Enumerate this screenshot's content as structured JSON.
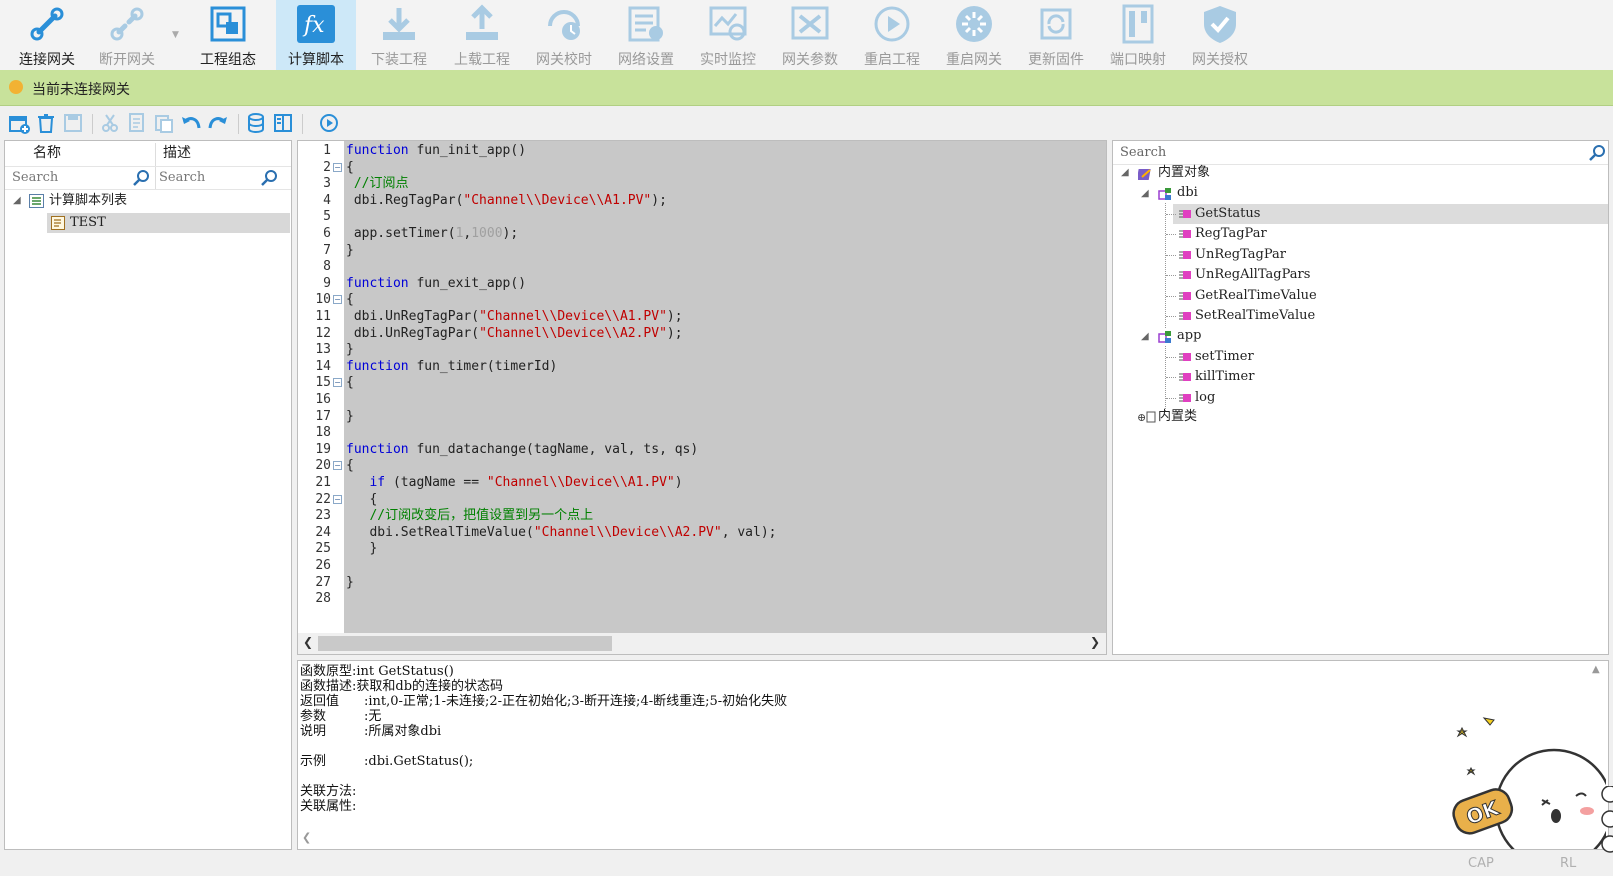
{
  "ribbon": {
    "items": [
      {
        "label": "连接网关",
        "icon": "connect-icon",
        "enabled": true
      },
      {
        "label": "断开网关",
        "icon": "disconnect-icon",
        "enabled": false
      },
      {
        "label": "工程组态",
        "icon": "project-config-icon",
        "enabled": true
      },
      {
        "label": "计算脚本",
        "icon": "fx-script-icon",
        "enabled": true,
        "selected": true
      },
      {
        "label": "下装工程",
        "icon": "download-icon",
        "enabled": false
      },
      {
        "label": "上载工程",
        "icon": "upload-icon",
        "enabled": false
      },
      {
        "label": "网关校时",
        "icon": "clock-sync-icon",
        "enabled": false
      },
      {
        "label": "网络设置",
        "icon": "network-settings-icon",
        "enabled": false
      },
      {
        "label": "实时监控",
        "icon": "monitor-icon",
        "enabled": false
      },
      {
        "label": "网关参数",
        "icon": "gateway-params-icon",
        "enabled": false
      },
      {
        "label": "重启工程",
        "icon": "restart-project-icon",
        "enabled": false
      },
      {
        "label": "重启网关",
        "icon": "restart-gateway-icon",
        "enabled": false
      },
      {
        "label": "更新固件",
        "icon": "firmware-update-icon",
        "enabled": false
      },
      {
        "label": "端口映射",
        "icon": "port-mapping-icon",
        "enabled": false
      },
      {
        "label": "网关授权",
        "icon": "license-shield-icon",
        "enabled": false
      }
    ],
    "accent_color": "#2a8fd8",
    "disabled_color": "#a9cbe3"
  },
  "status": {
    "text": "当前未连接网关",
    "color": "#c8e29b"
  },
  "toolbar": {
    "icons": [
      "new-script-icon",
      "delete-icon",
      "save-icon",
      "cut-icon",
      "copy-icon",
      "paste-icon",
      "undo-icon",
      "redo-icon",
      "database-icon",
      "book-icon",
      "run-icon"
    ]
  },
  "left": {
    "col_name": "名称",
    "col_desc": "描述",
    "search1": "Search",
    "search2": "Search",
    "root": "计算脚本列表",
    "child": "TEST"
  },
  "editor": {
    "line_numbers": [
      "1",
      "2",
      "3",
      "4",
      "5",
      "6",
      "7",
      "8",
      "9",
      "10",
      "11",
      "12",
      "13",
      "14",
      "15",
      "16",
      "17",
      "18",
      "19",
      "20",
      "21",
      "22",
      "23",
      "24",
      "25",
      "26",
      "27",
      "28"
    ],
    "lines": {
      "l1": {
        "kw": "function",
        "rest": " fun_init_app()"
      },
      "l2": "{",
      "l3": " //订阅点",
      "l4": {
        "a": " dbi.RegTagPar(",
        "s": "\"Channel\\\\Device\\\\A1.PV\"",
        "b": ");"
      },
      "l6": {
        "a": " app.setTimer(",
        "n1": "1",
        "c": ",",
        "n2": "1000",
        "b": ");"
      },
      "l7": "}",
      "l9": {
        "kw": "function",
        "rest": " fun_exit_app()"
      },
      "l10": "{",
      "l11": {
        "a": " dbi.UnRegTagPar(",
        "s": "\"Channel\\\\Device\\\\A1.PV\"",
        "b": ");"
      },
      "l12": {
        "a": " dbi.UnRegTagPar(",
        "s": "\"Channel\\\\Device\\\\A2.PV\"",
        "b": ");"
      },
      "l13": "}",
      "l14": {
        "kw": "function",
        "rest": " fun_timer(timerId)"
      },
      "l15": "{",
      "l17": "}",
      "l19": {
        "kw": "function",
        "rest": " fun_datachange(tagName, val, ts, qs)"
      },
      "l20": "{",
      "l21": {
        "pre": "   ",
        "kw": "if",
        "a": " (tagName == ",
        "s": "\"Channel\\\\Device\\\\A1.PV\"",
        "b": ")"
      },
      "l22": "   {",
      "l23": "   //订阅改变后，把值设置到另一个点上",
      "l24": {
        "a": "   dbi.SetRealTimeValue(",
        "s": "\"Channel\\\\Device\\\\A2.PV\"",
        "b": ", val);"
      },
      "l25": "   }",
      "l27": "}"
    }
  },
  "right": {
    "search": "Search",
    "root": "内置对象",
    "dbi": "dbi",
    "dbi_items": [
      "GetStatus",
      "RegTagPar",
      "UnRegTagPar",
      "UnRegAllTagPars",
      "GetRealTimeValue",
      "SetRealTimeValue"
    ],
    "app": "app",
    "app_items": [
      "setTimer",
      "killTimer",
      "log"
    ],
    "classes": "内置类"
  },
  "info": {
    "proto_k": "函数原型:",
    "proto_v": "int GetStatus()",
    "desc_k": "函数描述:",
    "desc_v": "获取和db的连接的状态码",
    "ret_k": "返回值",
    "ret_v": ":int,0-正常;1-未连接;2-正在初始化;3-断开连接;4-断线重连;5-初始化失败",
    "param_k": "参数",
    "param_v": ":无",
    "note_k": "说明",
    "note_v": ":所属对象dbi",
    "ex_k": "示例",
    "ex_v": ":dbi.GetStatus();",
    "rm_k": "关联方法:",
    "rp_k": "关联属性:"
  },
  "footer": {
    "caps": "CAP",
    "rl": "RL"
  }
}
